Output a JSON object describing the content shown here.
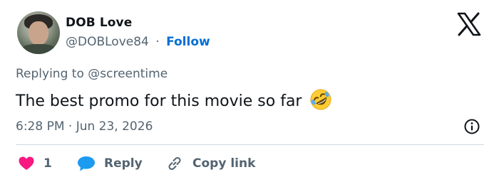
{
  "author": {
    "name": "DOB Love",
    "handle": "@DOBLove84",
    "separator": "·",
    "follow_label": "Follow"
  },
  "tweet": {
    "replying_to": "Replying to @screentime",
    "text": "The best promo for this movie so far",
    "timestamp": "6:28 PM · Jun 23, 2026"
  },
  "actions": {
    "like_count": "1",
    "reply_label": "Reply",
    "copy_label": "Copy link"
  },
  "icons": {
    "brand": "x-logo-icon",
    "emoji": "rolling-on-floor-laughing-emoji",
    "info": "info-icon",
    "like": "heart-icon",
    "reply": "speech-bubble-icon",
    "copy": "link-icon"
  },
  "colors": {
    "follow": "#006fd6",
    "like": "#f91880",
    "reply": "#1d9bf0",
    "secondary_text": "#536471"
  }
}
